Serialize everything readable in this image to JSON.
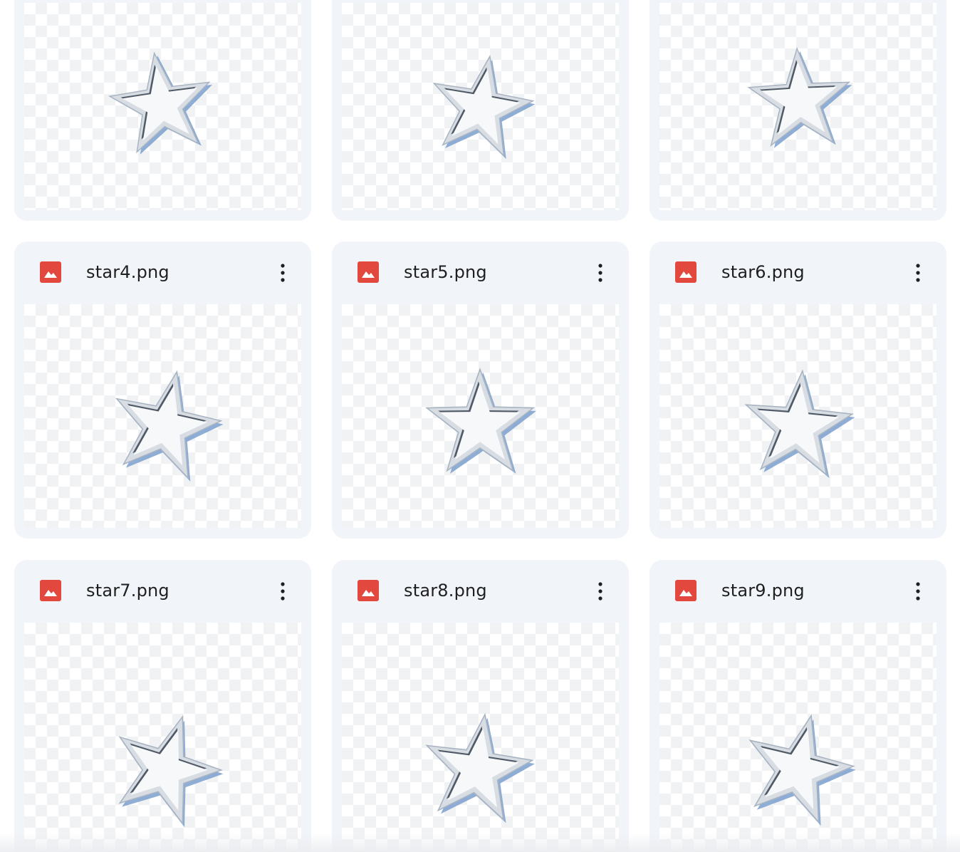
{
  "files": [
    {
      "name": "",
      "icon": "image-file-icon",
      "star_tilt": -8
    },
    {
      "name": "",
      "icon": "image-file-icon",
      "star_tilt": 10
    },
    {
      "name": "",
      "icon": "image-file-icon",
      "star_tilt": -3
    },
    {
      "name": "star4.png",
      "icon": "image-file-icon",
      "star_tilt": 12
    },
    {
      "name": "star5.png",
      "icon": "image-file-icon",
      "star_tilt": 0
    },
    {
      "name": "star6.png",
      "icon": "image-file-icon",
      "star_tilt": 5
    },
    {
      "name": "star7.png",
      "icon": "image-file-icon",
      "star_tilt": 18
    },
    {
      "name": "star8.png",
      "icon": "image-file-icon",
      "star_tilt": 8
    },
    {
      "name": "star9.png",
      "icon": "image-file-icon",
      "star_tilt": 14
    }
  ],
  "colors": {
    "card_bg": "#f1f4f9",
    "icon_red": "#e2483d",
    "text": "#1f1f1f",
    "star_silver": "#d8dde3",
    "star_blue": "#7aa0cf"
  },
  "icons": {
    "file": "image-file-icon",
    "more": "more-vert-icon"
  }
}
